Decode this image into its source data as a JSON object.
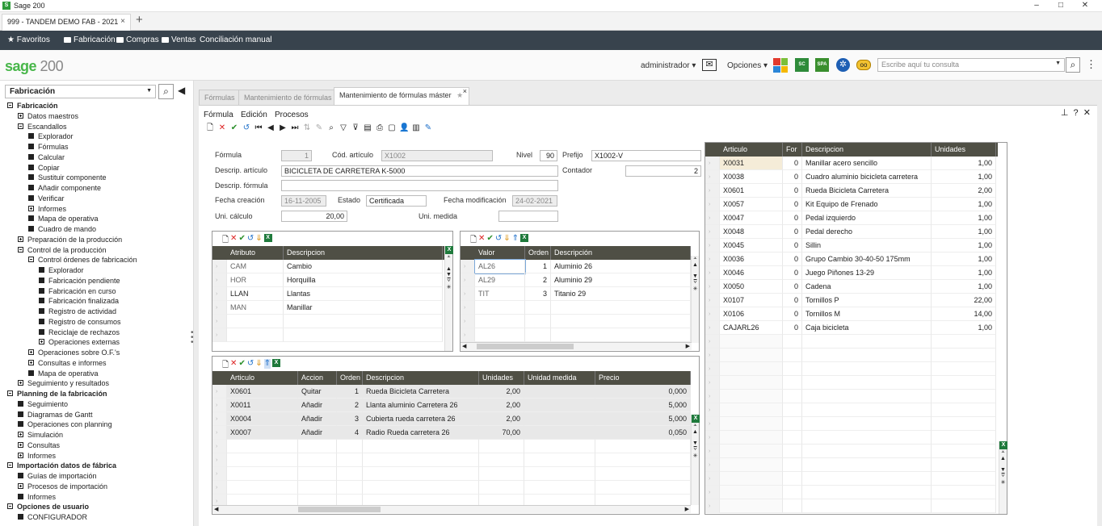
{
  "window": {
    "title": "Sage 200",
    "minimize": "–",
    "maximize": "□",
    "close": "✕"
  },
  "browser_tab": {
    "label": "999 - TANDEM DEMO FAB - 2021",
    "close": "×",
    "new": "+"
  },
  "favbar": {
    "favoritos": "Favoritos",
    "items": [
      "Fabricación",
      "Compras",
      "Ventas",
      "Conciliación manual"
    ]
  },
  "header": {
    "logo": "sage",
    "logo_num": "200",
    "user": "administrador",
    "opciones": "Opciones",
    "sc": "SC",
    "spa": "SPA",
    "search_placeholder": "Escribe aquí tu consulta"
  },
  "sidebar": {
    "module": "Fabricación",
    "tree": [
      {
        "label": "Fabricación",
        "level": 0,
        "icon": "minus",
        "bold": true
      },
      {
        "label": "Datos maestros",
        "level": 1,
        "icon": "plus"
      },
      {
        "label": "Escandallos",
        "level": 1,
        "icon": "minus"
      },
      {
        "label": "Explorador",
        "level": 2,
        "icon": "box"
      },
      {
        "label": "Fórmulas",
        "level": 2,
        "icon": "box"
      },
      {
        "label": "Calcular",
        "level": 2,
        "icon": "box"
      },
      {
        "label": "Copiar",
        "level": 2,
        "icon": "box"
      },
      {
        "label": "Sustituir componente",
        "level": 2,
        "icon": "box"
      },
      {
        "label": "Añadir componente",
        "level": 2,
        "icon": "box"
      },
      {
        "label": "Verificar",
        "level": 2,
        "icon": "box"
      },
      {
        "label": "Informes",
        "level": 2,
        "icon": "plus"
      },
      {
        "label": "Mapa de operativa",
        "level": 2,
        "icon": "box"
      },
      {
        "label": "Cuadro de mando",
        "level": 2,
        "icon": "box"
      },
      {
        "label": "Preparación de la producción",
        "level": 1,
        "icon": "plus"
      },
      {
        "label": "Control de la producción",
        "level": 1,
        "icon": "minus"
      },
      {
        "label": "Control órdenes de fabricación",
        "level": 2,
        "icon": "minus"
      },
      {
        "label": "Explorador",
        "level": 3,
        "icon": "box"
      },
      {
        "label": "Fabricación pendiente",
        "level": 3,
        "icon": "box"
      },
      {
        "label": "Fabricación en curso",
        "level": 3,
        "icon": "box"
      },
      {
        "label": "Fabricación finalizada",
        "level": 3,
        "icon": "box"
      },
      {
        "label": "Registro de actividad",
        "level": 3,
        "icon": "box"
      },
      {
        "label": "Registro de consumos",
        "level": 3,
        "icon": "box"
      },
      {
        "label": "Reciclaje de rechazos",
        "level": 3,
        "icon": "box"
      },
      {
        "label": "Operaciones externas",
        "level": 3,
        "icon": "plus"
      },
      {
        "label": "Operaciones sobre O.F.'s",
        "level": 2,
        "icon": "plus"
      },
      {
        "label": "Consultas e informes",
        "level": 2,
        "icon": "plus"
      },
      {
        "label": "Mapa de operativa",
        "level": 2,
        "icon": "box"
      },
      {
        "label": "Seguimiento y resultados",
        "level": 1,
        "icon": "plus"
      },
      {
        "label": "Planning de la fabricación",
        "level": 0,
        "icon": "minus",
        "bold": true
      },
      {
        "label": "Seguimiento",
        "level": 1,
        "icon": "box"
      },
      {
        "label": "Diagramas de Gantt",
        "level": 1,
        "icon": "box"
      },
      {
        "label": "Operaciones con planning",
        "level": 1,
        "icon": "box"
      },
      {
        "label": "Simulación",
        "level": 1,
        "icon": "plus"
      },
      {
        "label": "Consultas",
        "level": 1,
        "icon": "plus"
      },
      {
        "label": "Informes",
        "level": 1,
        "icon": "plus"
      },
      {
        "label": "Importación datos de fábrica",
        "level": 0,
        "icon": "minus",
        "bold": true
      },
      {
        "label": "Guías de importación",
        "level": 1,
        "icon": "box"
      },
      {
        "label": "Procesos de importación",
        "level": 1,
        "icon": "plus"
      },
      {
        "label": "Informes",
        "level": 1,
        "icon": "box"
      },
      {
        "label": "Opciones de usuario",
        "level": 0,
        "icon": "minus",
        "bold": true
      },
      {
        "label": "CONFIGURADOR",
        "level": 1,
        "icon": "box"
      }
    ]
  },
  "doc_tabs": [
    "Fórmulas",
    "Mantenimiento de fórmulas",
    "Mantenimiento de fórmulas máster"
  ],
  "menu": {
    "formula": "Fórmula",
    "edicion": "Edición",
    "procesos": "Procesos"
  },
  "form": {
    "formula_label": "Fórmula",
    "formula_value": "1",
    "cod_articulo_label": "Cód. artículo",
    "cod_articulo_value": "X1002",
    "nivel_label": "Nivel",
    "nivel_value": "90",
    "prefijo_label": "Prefijo",
    "prefijo_value": "X1002-V",
    "descrip_articulo_label": "Descrip. artículo",
    "descrip_articulo_value": "BICICLETA DE CARRETERA K-5000",
    "contador_label": "Contador",
    "contador_value": "2",
    "descrip_formula_label": "Descrip. fórmula",
    "descrip_formula_value": "",
    "fecha_creacion_label": "Fecha creación",
    "fecha_creacion_value": "16-11-2005",
    "estado_label": "Estado",
    "estado_value": "Certificada",
    "fecha_mod_label": "Fecha modificación",
    "fecha_mod_value": "24-02-2021",
    "uni_calculo_label": "Uni. cálculo",
    "uni_calculo_value": "20,00",
    "uni_medida_label": "Uni. medida",
    "uni_medida_value": ""
  },
  "grid_atributos": {
    "headers": [
      "Atributo",
      "Descripcion"
    ],
    "rows": [
      [
        "CAM",
        "Cambio"
      ],
      [
        "HOR",
        "Horquilla"
      ],
      [
        "LLAN",
        "Llantas"
      ],
      [
        "MAN",
        "Manillar"
      ]
    ]
  },
  "grid_valores": {
    "headers": [
      "Valor",
      "Orden",
      "Descripción"
    ],
    "rows": [
      [
        "AL26",
        "1",
        "Aluminio 26"
      ],
      [
        "AL29",
        "2",
        "Aluminio 29"
      ],
      [
        "TIT",
        "3",
        "Titanio 29"
      ]
    ]
  },
  "grid_acciones": {
    "headers": [
      "Articulo",
      "Accion",
      "Orden",
      "Descripcion",
      "Unidades",
      "Unidad medida",
      "Precio"
    ],
    "rows": [
      [
        "X0601",
        "Quitar",
        "1",
        "Rueda Bicicleta Carretera",
        "2,00",
        "",
        "0,000"
      ],
      [
        "X0011",
        "Añadir",
        "2",
        "Llanta aluminio Carretera 26",
        "2,00",
        "",
        "5,000"
      ],
      [
        "X0004",
        "Añadir",
        "3",
        "Cubierta rueda carretera 26",
        "2,00",
        "",
        "5,000"
      ],
      [
        "X0007",
        "Añadir",
        "4",
        "Radio Rueda carretera 26",
        "70,00",
        "",
        "0,050"
      ]
    ]
  },
  "grid_componentes": {
    "headers": [
      "Articulo",
      "For",
      "Descripcion",
      "Unidades"
    ],
    "rows": [
      [
        "X0031",
        "0",
        "Manillar acero sencillo",
        "1,00"
      ],
      [
        "X0038",
        "0",
        "Cuadro aluminio bicicleta carretera",
        "1,00"
      ],
      [
        "X0601",
        "0",
        "Rueda Bicicleta Carretera",
        "2,00"
      ],
      [
        "X0057",
        "0",
        "Kit Equipo de Frenado",
        "1,00"
      ],
      [
        "X0047",
        "0",
        "Pedal izquierdo",
        "1,00"
      ],
      [
        "X0048",
        "0",
        "Pedal derecho",
        "1,00"
      ],
      [
        "X0045",
        "0",
        "Sillin",
        "1,00"
      ],
      [
        "X0036",
        "0",
        "Grupo Cambio 30-40-50 175mm",
        "1,00"
      ],
      [
        "X0046",
        "0",
        "Juego Piñones 13-29",
        "1,00"
      ],
      [
        "X0050",
        "0",
        "Cadena",
        "1,00"
      ],
      [
        "X0107",
        "0",
        "Tornillos P",
        "22,00"
      ],
      [
        "X0106",
        "0",
        "Tornillos M",
        "14,00"
      ],
      [
        "CAJARL26",
        "0",
        "Caja bicicleta",
        "1,00"
      ]
    ]
  },
  "colors": {
    "brand": "#47b649",
    "nav": "#38434d",
    "grid_header": "#4f4f45"
  }
}
